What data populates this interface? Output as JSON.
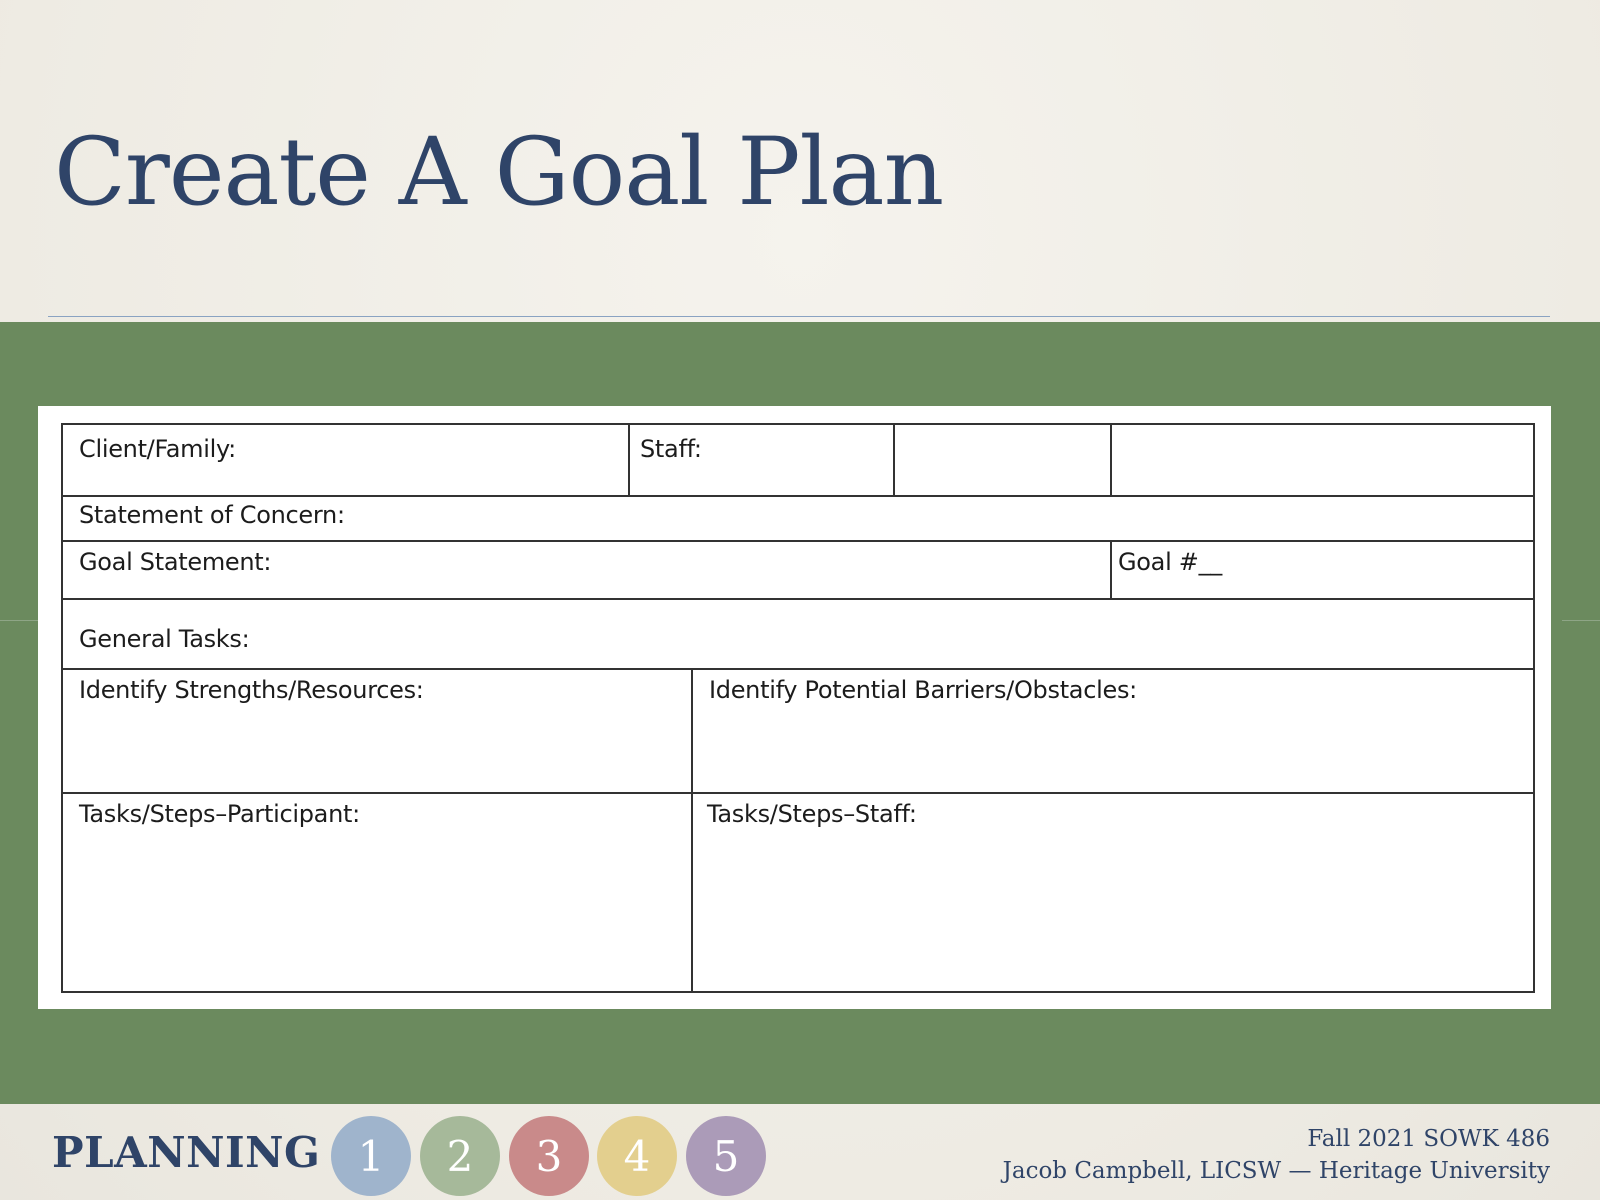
{
  "slide": {
    "title": "Create A Goal Plan"
  },
  "form": {
    "client_family": "Client/Family:",
    "staff": "Staff:",
    "statement_of_concern": "Statement of Concern:",
    "goal_statement": "Goal Statement:",
    "goal_number": "Goal #__",
    "general_tasks": "General Tasks:",
    "strengths": "Identify Strengths/Resources:",
    "barriers": "Identify Potential Barriers/Obstacles:",
    "tasks_participant": "Tasks/Steps–Participant:",
    "tasks_staff": "Tasks/Steps–Staff:"
  },
  "footer": {
    "section": "PLANNING",
    "steps": [
      {
        "label": "1",
        "color": "#9fb4cc"
      },
      {
        "label": "2",
        "color": "#a6b99a"
      },
      {
        "label": "3",
        "color": "#c98a8a"
      },
      {
        "label": "4",
        "color": "#e3cf8e"
      },
      {
        "label": "5",
        "color": "#ab9bb8"
      }
    ],
    "course": "Fall 2021 SOWK 486",
    "author": "Jacob Campbell, LICSW — Heritage University"
  },
  "colors": {
    "title": "#2f4468",
    "band": "#6b8a5e",
    "background": "#f1efe8"
  }
}
